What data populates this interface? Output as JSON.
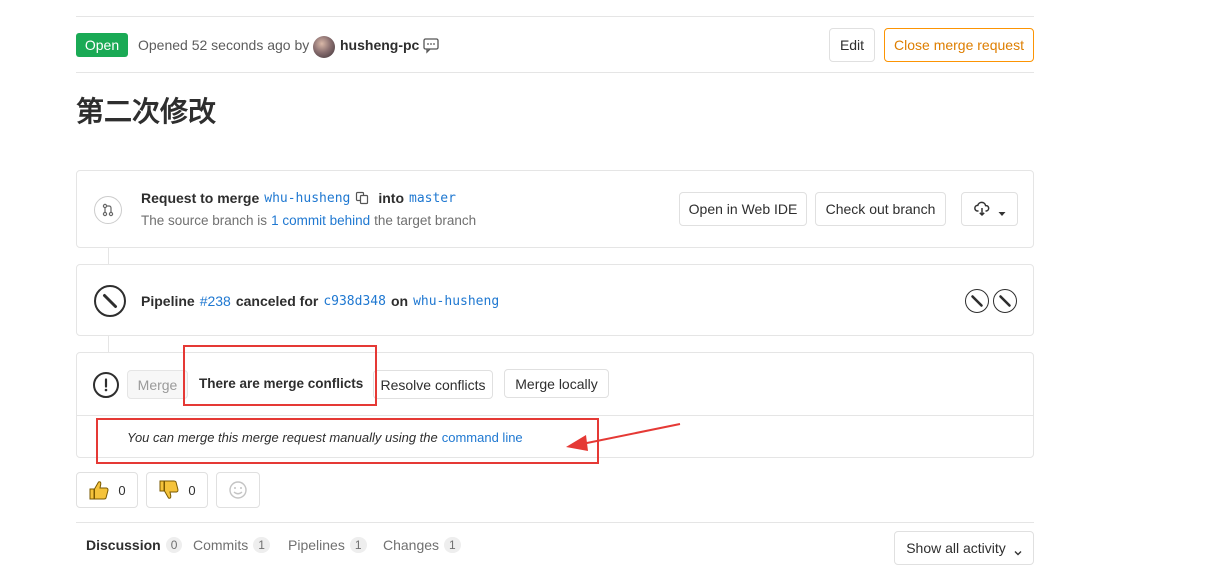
{
  "header": {
    "status_badge": "Open",
    "opened_text": "Opened 52 seconds ago by",
    "author": "husheng-pc",
    "edit_label": "Edit",
    "close_label": "Close merge request"
  },
  "title": "第二次修改",
  "request": {
    "prefix": "Request to merge",
    "source_branch": "whu-husheng",
    "into": "into",
    "target_branch": "master",
    "behind_prefix": "The source branch is",
    "behind_link": "1 commit behind",
    "behind_suffix": "the target branch",
    "web_ide_label": "Open in Web IDE",
    "checkout_label": "Check out branch"
  },
  "pipeline": {
    "label": "Pipeline",
    "id": "#238",
    "status_text": "canceled for",
    "commit": "c938d348",
    "on": "on",
    "branch": "whu-husheng"
  },
  "merge": {
    "merge_label": "Merge",
    "conflicts_text": "There are merge conflicts",
    "resolve_label": "Resolve conflicts",
    "locally_label": "Merge locally",
    "manual_text": "You can merge this merge request manually using the",
    "command_line_link": "command line"
  },
  "awards": {
    "thumbsup_count": "0",
    "thumbsdown_count": "0"
  },
  "tabs": [
    {
      "label": "Discussion",
      "count": "0"
    },
    {
      "label": "Commits",
      "count": "1"
    },
    {
      "label": "Pipelines",
      "count": "1"
    },
    {
      "label": "Changes",
      "count": "1"
    }
  ],
  "activity_filter": "Show all activity",
  "colors": {
    "open_green": "#1aaa55",
    "close_orange": "#fc9403",
    "link_blue": "#1f78d1",
    "annotation_red": "#e53935"
  }
}
